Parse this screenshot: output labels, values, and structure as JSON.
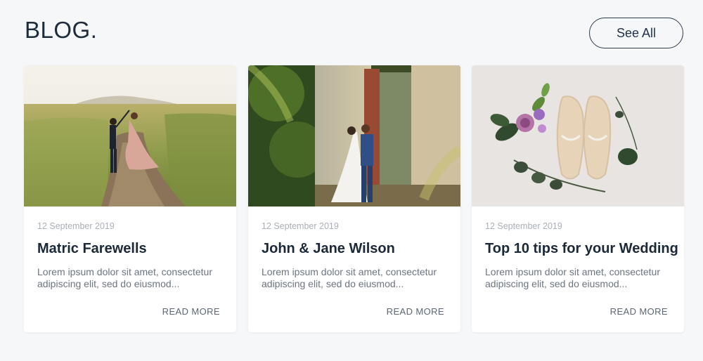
{
  "header": {
    "title": "BLOG.",
    "see_all_label": "See All"
  },
  "posts": [
    {
      "date": "12 September 2019",
      "title": "Matric Farewells",
      "excerpt": "Lorem ipsum dolor sit amet, consectetur adipiscing elit, sed do eiusmod...",
      "read_more": "READ MORE",
      "image": "couple-dancing-wheat-field-photo"
    },
    {
      "date": "12 September 2019",
      "title": "John & Jane Wilson",
      "excerpt": "Lorem ipsum dolor sit amet, consectetur adipiscing elit, sed do eiusmod...",
      "read_more": "READ MORE",
      "image": "wedding-couple-ruins-photo"
    },
    {
      "date": "12 September 2019",
      "title": "Top 10 tips for your Wedding",
      "excerpt": "Lorem ipsum dolor sit amet, consectetur adipiscing elit, sed do eiusmod...",
      "read_more": "READ MORE",
      "image": "wedding-shoes-flowers-photo"
    }
  ],
  "colors": {
    "background": "#f6f7f8",
    "card": "#ffffff",
    "title": "#1b2838",
    "muted": "#a9b0b8",
    "body": "#6c7580"
  }
}
